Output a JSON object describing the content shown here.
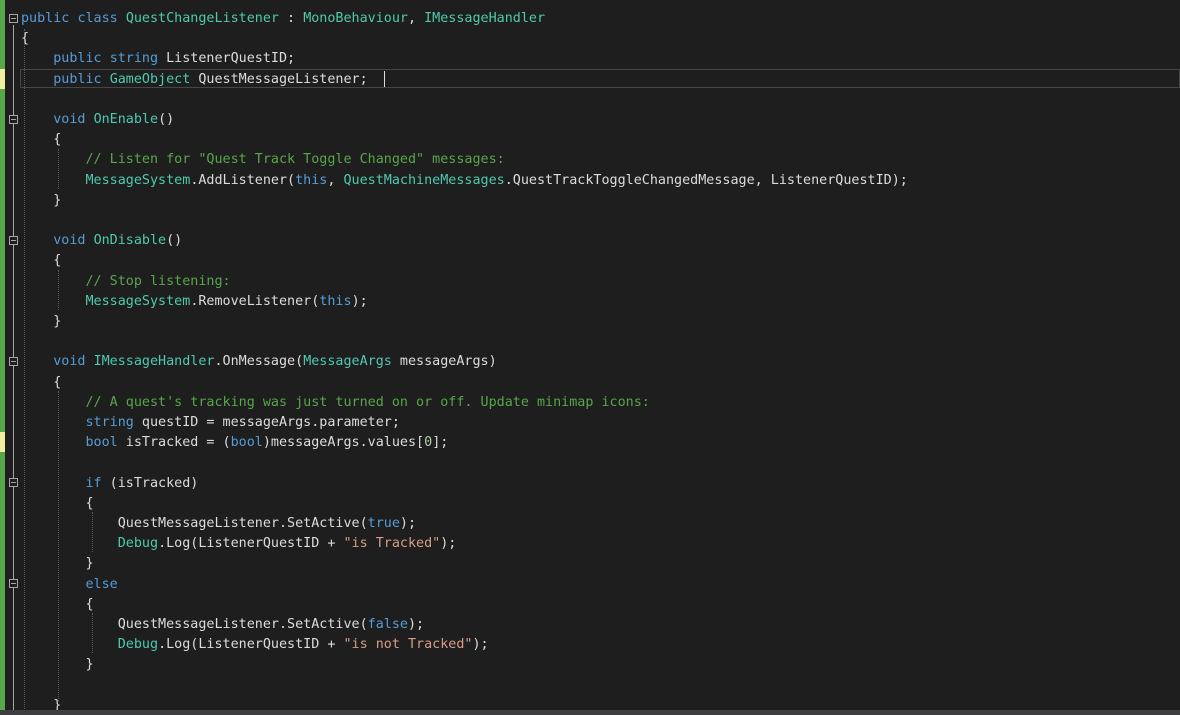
{
  "colors": {
    "background": "#1e1e1e",
    "keyword": "#569cd6",
    "type": "#4ec9b0",
    "comment": "#57a64a",
    "string": "#d69d85",
    "number": "#b5cea8",
    "identifier": "#dcdcdc",
    "change_saved": "#57a64a",
    "change_unsaved": "#efefa0"
  },
  "icons": {
    "fold": "collapse-minus-icon"
  },
  "code": {
    "lines": [
      [
        [
          "kw",
          "public"
        ],
        [
          "id",
          " "
        ],
        [
          "kw",
          "class"
        ],
        [
          "id",
          " "
        ],
        [
          "ty",
          "QuestChangeListener"
        ],
        [
          "id",
          " : "
        ],
        [
          "ty",
          "MonoBehaviour"
        ],
        [
          "id",
          ", "
        ],
        [
          "ty",
          "IMessageHandler"
        ]
      ],
      [
        [
          "id",
          "{"
        ]
      ],
      [
        [
          "id",
          "    "
        ],
        [
          "kw",
          "public"
        ],
        [
          "id",
          " "
        ],
        [
          "kw",
          "string"
        ],
        [
          "id",
          " ListenerQuestID;"
        ]
      ],
      [
        [
          "id",
          "    "
        ],
        [
          "kw",
          "public"
        ],
        [
          "id",
          " "
        ],
        [
          "ty",
          "GameObject"
        ],
        [
          "id",
          " QuestMessageListener;"
        ]
      ],
      [],
      [
        [
          "id",
          "    "
        ],
        [
          "kw",
          "void"
        ],
        [
          "id",
          " "
        ],
        [
          "ty",
          "OnEnable"
        ],
        [
          "id",
          "()"
        ]
      ],
      [
        [
          "id",
          "    {"
        ]
      ],
      [
        [
          "id",
          "        "
        ],
        [
          "cm",
          "// Listen for \"Quest Track Toggle Changed\" messages:"
        ]
      ],
      [
        [
          "id",
          "        "
        ],
        [
          "ty",
          "MessageSystem"
        ],
        [
          "id",
          ".AddListener("
        ],
        [
          "kw",
          "this"
        ],
        [
          "id",
          ", "
        ],
        [
          "ty",
          "QuestMachineMessages"
        ],
        [
          "id",
          ".QuestTrackToggleChangedMessage, ListenerQuestID);"
        ]
      ],
      [
        [
          "id",
          "    }"
        ]
      ],
      [],
      [
        [
          "id",
          "    "
        ],
        [
          "kw",
          "void"
        ],
        [
          "id",
          " "
        ],
        [
          "ty",
          "OnDisable"
        ],
        [
          "id",
          "()"
        ]
      ],
      [
        [
          "id",
          "    {"
        ]
      ],
      [
        [
          "id",
          "        "
        ],
        [
          "cm",
          "// Stop listening:"
        ]
      ],
      [
        [
          "id",
          "        "
        ],
        [
          "ty",
          "MessageSystem"
        ],
        [
          "id",
          ".RemoveListener("
        ],
        [
          "kw",
          "this"
        ],
        [
          "id",
          ");"
        ]
      ],
      [
        [
          "id",
          "    }"
        ]
      ],
      [],
      [
        [
          "id",
          "    "
        ],
        [
          "kw",
          "void"
        ],
        [
          "id",
          " "
        ],
        [
          "ty",
          "IMessageHandler"
        ],
        [
          "id",
          ".OnMessage("
        ],
        [
          "ty",
          "MessageArgs"
        ],
        [
          "id",
          " messageArgs)"
        ]
      ],
      [
        [
          "id",
          "    {"
        ]
      ],
      [
        [
          "id",
          "        "
        ],
        [
          "cm",
          "// A quest's tracking was just turned on or off. Update minimap icons:"
        ]
      ],
      [
        [
          "id",
          "        "
        ],
        [
          "kw",
          "string"
        ],
        [
          "id",
          " questID = messageArgs.parameter;"
        ]
      ],
      [
        [
          "id",
          "        "
        ],
        [
          "kw",
          "bool"
        ],
        [
          "id",
          " isTracked = ("
        ],
        [
          "kw",
          "bool"
        ],
        [
          "id",
          ")messageArgs.values["
        ],
        [
          "nm",
          "0"
        ],
        [
          "id",
          "];"
        ]
      ],
      [],
      [
        [
          "id",
          "        "
        ],
        [
          "kw",
          "if"
        ],
        [
          "id",
          " (isTracked)"
        ]
      ],
      [
        [
          "id",
          "        {"
        ]
      ],
      [
        [
          "id",
          "            QuestMessageListener.SetActive("
        ],
        [
          "kw",
          "true"
        ],
        [
          "id",
          ");"
        ]
      ],
      [
        [
          "id",
          "            "
        ],
        [
          "ty",
          "Debug"
        ],
        [
          "id",
          ".Log(ListenerQuestID + "
        ],
        [
          "st",
          "\"is Tracked\""
        ],
        [
          "id",
          ");"
        ]
      ],
      [
        [
          "id",
          "        }"
        ]
      ],
      [
        [
          "id",
          "        "
        ],
        [
          "kw",
          "else"
        ]
      ],
      [
        [
          "id",
          "        {"
        ]
      ],
      [
        [
          "id",
          "            QuestMessageListener.SetActive("
        ],
        [
          "kw",
          "false"
        ],
        [
          "id",
          ");"
        ]
      ],
      [
        [
          "id",
          "            "
        ],
        [
          "ty",
          "Debug"
        ],
        [
          "id",
          ".Log(ListenerQuestID + "
        ],
        [
          "st",
          "\"is not Tracked\""
        ],
        [
          "id",
          ");"
        ]
      ],
      [
        [
          "id",
          "        }"
        ]
      ],
      [],
      [
        [
          "id",
          "    }"
        ]
      ]
    ]
  }
}
